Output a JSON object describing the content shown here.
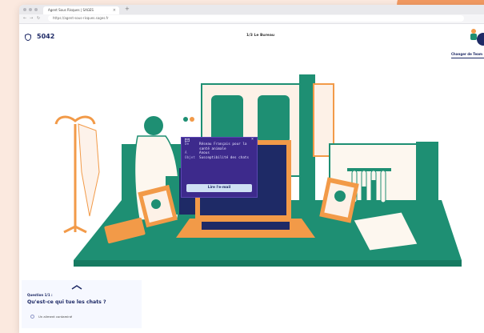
{
  "browser": {
    "tab_title": "Agent Sous Risques | SAGES",
    "url": "https://agent-sous-risques.sages.fr",
    "new_tab": "+",
    "tab_close": "×"
  },
  "header": {
    "score": "5042",
    "scene_label": "1/3 Le Bureau",
    "change_team": "Changer de Team"
  },
  "email_popup": {
    "from_label": "De",
    "from_value": "Réseau Français pour la santé animale",
    "to_label": "À",
    "to_value": "Anous",
    "subject_label": "Objet",
    "subject_value": "Susceptibilité des chats",
    "button_label": "Lire l'e-mail",
    "close": "×"
  },
  "question": {
    "number": "Question 1/1 :",
    "text": "Qu'est-ce qui tue les chats ?",
    "options": [
      "Un aliment contaminé"
    ]
  },
  "colors": {
    "teal": "#1e8f73",
    "orange": "#f29a48",
    "navy": "#1e2a66",
    "popup_bg": "#3d2a8c"
  }
}
